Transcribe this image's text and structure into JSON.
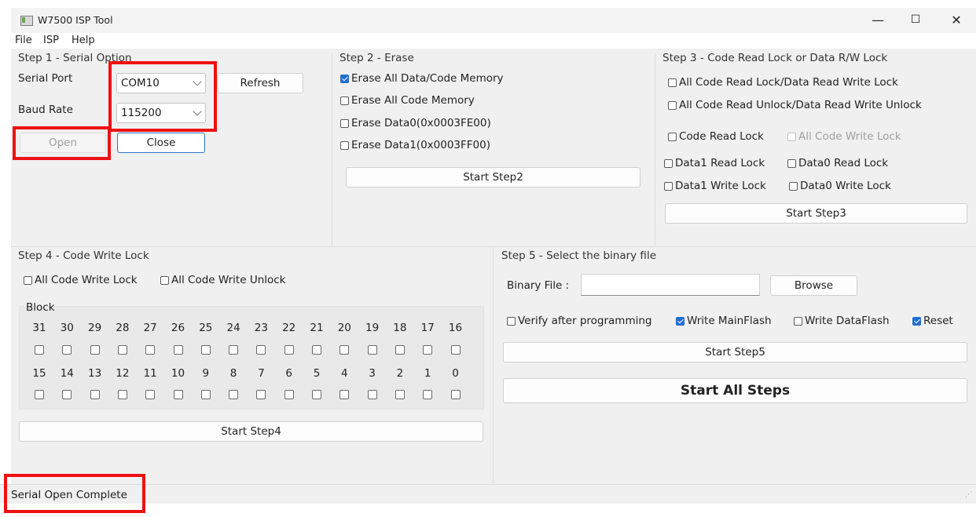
{
  "window": {
    "title": "W7500 ISP Tool",
    "controls": {
      "minimize": "—",
      "maximize": "☐",
      "close": "✕"
    }
  },
  "menu": [
    "File",
    "ISP",
    "Help"
  ],
  "step1": {
    "title": "Step 1 - Serial Option",
    "serial_port_label": "Serial Port",
    "serial_port_value": "COM10",
    "baud_rate_label": "Baud Rate",
    "baud_rate_value": "115200",
    "refresh_label": "Refresh",
    "open_label": "Open",
    "close_label": "Close"
  },
  "step2": {
    "title": "Step 2 - Erase",
    "options": [
      {
        "label": "Erase All Data/Code Memory",
        "checked": true
      },
      {
        "label": "Erase All Code Memory",
        "checked": false
      },
      {
        "label": "Erase Data0(0x0003FE00)",
        "checked": false
      },
      {
        "label": "Erase Data1(0x0003FF00)",
        "checked": false
      }
    ],
    "start_label": "Start Step2"
  },
  "step3": {
    "title": "Step 3 - Code Read Lock or Data R/W Lock",
    "all_lock": "All Code Read Lock/Data Read Write Lock",
    "all_unlock": "All Code Read Unlock/Data Read Write Unlock",
    "code_read_lock": "Code Read Lock",
    "all_code_write_lock": "All Code Write Lock",
    "data1_read_lock": "Data1 Read Lock",
    "data0_read_lock": "Data0 Read Lock",
    "data1_write_lock": "Data1 Write Lock",
    "data0_write_lock": "Data0 Write Lock",
    "start_label": "Start Step3"
  },
  "step4": {
    "title": "Step 4 - Code Write Lock",
    "all_write_lock": "All Code Write Lock",
    "all_write_unlock": "All Code Write Unlock",
    "block_label": "Block",
    "row1": [
      "31",
      "30",
      "29",
      "28",
      "27",
      "26",
      "25",
      "24",
      "23",
      "22",
      "21",
      "20",
      "19",
      "18",
      "17",
      "16"
    ],
    "row2": [
      "15",
      "14",
      "13",
      "12",
      "11",
      "10",
      "9",
      "8",
      "7",
      "6",
      "5",
      "4",
      "3",
      "2",
      "1",
      "0"
    ],
    "start_label": "Start Step4"
  },
  "step5": {
    "title": "Step 5 - Select the binary file",
    "binary_label": "Binary File :",
    "binary_value": "",
    "browse_label": "Browse",
    "verify_label": "Verify after programming",
    "write_main_label": "Write MainFlash",
    "write_data_label": "Write DataFlash",
    "reset_label": "Reset",
    "start_label": "Start Step5",
    "start_all_label": "Start All Steps"
  },
  "status": {
    "text": "Serial Open Complete"
  },
  "colors": {
    "highlight": "#ee1111",
    "check_accent": "#1f6fcf"
  }
}
